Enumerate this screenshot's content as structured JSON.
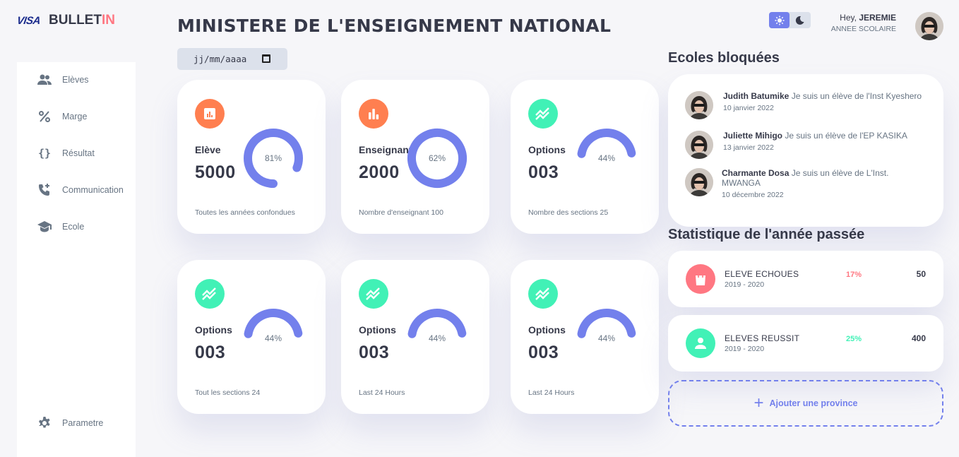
{
  "logo": {
    "mark": "VISA",
    "brand_main": "BULLET",
    "brand_accent": "IN"
  },
  "sidebar": {
    "items": [
      {
        "label": "Elèves",
        "icon": "users-icon"
      },
      {
        "label": "Marge",
        "icon": "percent-icon"
      },
      {
        "label": "Résultat",
        "icon": "braces-icon"
      },
      {
        "label": "Communication",
        "icon": "phone-add-icon"
      },
      {
        "label": "Ecole",
        "icon": "school-icon"
      }
    ],
    "settings": {
      "label": "Parametre",
      "icon": "gear-icon"
    }
  },
  "header": {
    "title": "MINISTERE DE L'ENSEIGNEMENT NATIONAL",
    "date_placeholder": "jj/mm/aaaa",
    "greeting": "Hey,",
    "user_name": "JEREMIE",
    "subtitle": "ANNEE SCOLAIRE"
  },
  "colors": {
    "primary": "#7380ec",
    "danger": "#ff7782",
    "success": "#41f1b6",
    "warning": "#ffbb55",
    "orange": "#ff7f50"
  },
  "cards": [
    {
      "title": "Elève",
      "value": "5000",
      "percent": 81,
      "percent_label": "81%",
      "footer": "Toutes les années confondues",
      "icon": "bar-chart-box-icon",
      "icon_color": "#ff7f50",
      "ring": "solid"
    },
    {
      "title": "Enseignant",
      "value": "2000",
      "percent": 62,
      "percent_label": "62%",
      "footer": "Nombre d'enseignant 100",
      "icon": "bar-chart-icon",
      "icon_color": "#ff7f50",
      "ring": "dashed"
    },
    {
      "title": "Options",
      "value": "003",
      "percent": 44,
      "percent_label": "44%",
      "footer": "Nombre des sections 25",
      "icon": "trending-icon",
      "icon_color": "#41f1b6",
      "ring": "solid"
    },
    {
      "title": "Options",
      "value": "003",
      "percent": 44,
      "percent_label": "44%",
      "footer": "Tout les sections 24",
      "icon": "trending-icon",
      "icon_color": "#41f1b6",
      "ring": "solid"
    },
    {
      "title": "Options",
      "value": "003",
      "percent": 44,
      "percent_label": "44%",
      "footer": "Last 24 Hours",
      "icon": "trending-icon",
      "icon_color": "#41f1b6",
      "ring": "solid"
    },
    {
      "title": "Options",
      "value": "003",
      "percent": 44,
      "percent_label": "44%",
      "footer": "Last 24 Hours",
      "icon": "trending-icon",
      "icon_color": "#41f1b6",
      "ring": "solid"
    }
  ],
  "blocked": {
    "title": "Ecoles bloquées",
    "items": [
      {
        "name": "Judith Batumike",
        "text": "Je suis un élève de l'Inst Kyeshero",
        "date": "10 janvier 2022"
      },
      {
        "name": "Juliette Mihigo",
        "text": "Je suis un élève de l'EP KASIKA",
        "date": "13 janvier 2022"
      },
      {
        "name": "Charmante Dosa",
        "text": "Je suis un élève de L'Inst. MWANGA",
        "date": "10 décembre 2022"
      }
    ]
  },
  "stats": {
    "title": "Statistique de l'année passée",
    "items": [
      {
        "name": "ELEVE ECHOUES",
        "year": "2019 - 2020",
        "percent": "17%",
        "count": "50",
        "icon": "shopping-bag-icon",
        "color": "#ff7782"
      },
      {
        "name": "ELEVES REUSSIT",
        "year": "2019 - 2020",
        "percent": "25%",
        "count": "400",
        "icon": "person-icon",
        "color": "#41f1b6"
      }
    ],
    "add_label": "Ajouter une province"
  }
}
